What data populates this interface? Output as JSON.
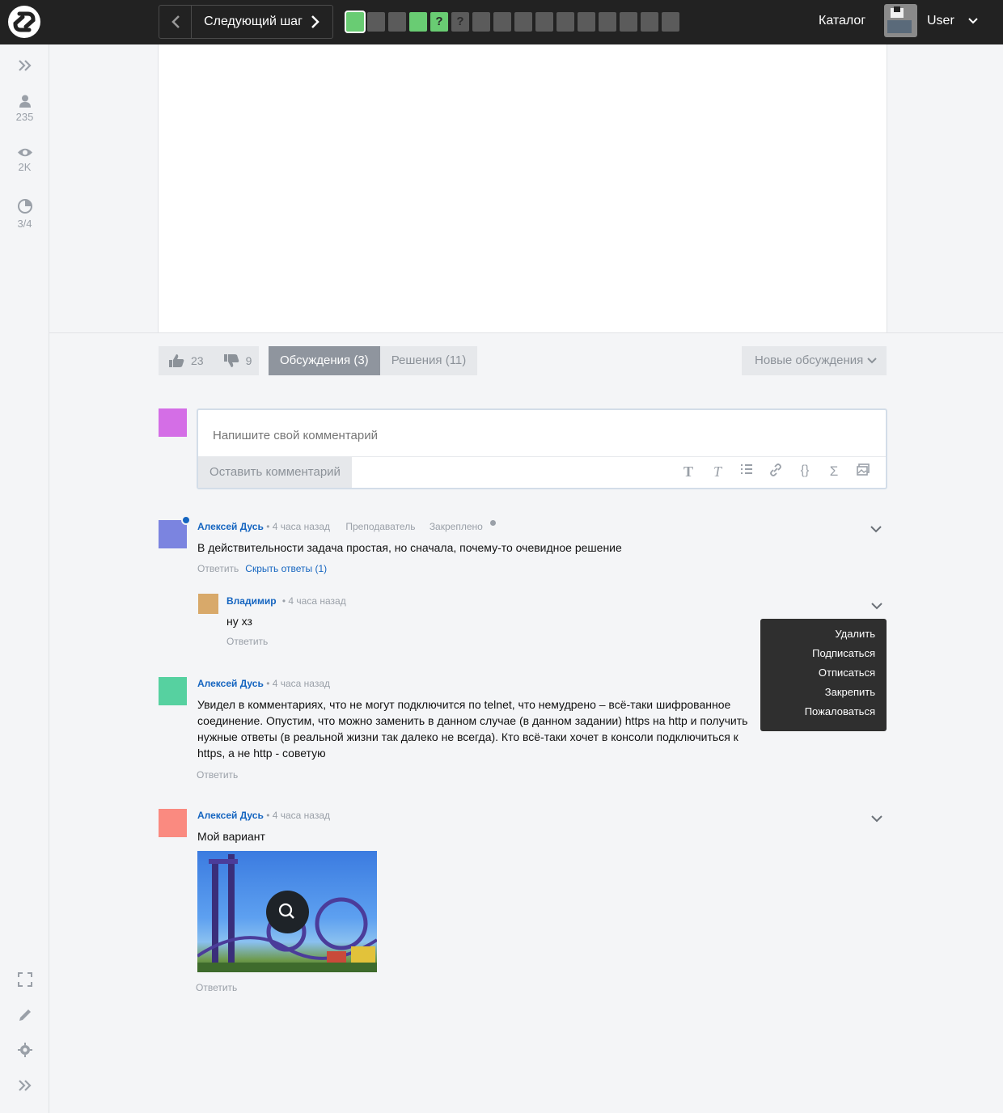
{
  "header": {
    "next_step_label": "Следующий шаг",
    "steps": [
      {
        "state": "green",
        "label": "",
        "active": true
      },
      {
        "state": "grey",
        "label": ""
      },
      {
        "state": "grey",
        "label": ""
      },
      {
        "state": "green",
        "label": ""
      },
      {
        "state": "green",
        "label": "?"
      },
      {
        "state": "grey",
        "label": "?"
      },
      {
        "state": "grey",
        "label": ""
      },
      {
        "state": "grey",
        "label": ""
      },
      {
        "state": "grey",
        "label": ""
      },
      {
        "state": "grey",
        "label": ""
      },
      {
        "state": "grey",
        "label": ""
      },
      {
        "state": "grey",
        "label": ""
      },
      {
        "state": "grey",
        "label": ""
      },
      {
        "state": "grey",
        "label": ""
      },
      {
        "state": "grey",
        "label": ""
      },
      {
        "state": "grey",
        "label": ""
      }
    ],
    "catalog_label": "Каталог",
    "user_name": "User"
  },
  "sidebar": {
    "learners": "235",
    "views": "2K",
    "progress": "3/4"
  },
  "discussion": {
    "likes": "23",
    "dislikes": "9",
    "tab_discussions": "Обсуждения (3)",
    "tab_solutions": "Решения (11)",
    "sort_label": "Новые обсуждения",
    "input_placeholder": "Напишите свой комментарий",
    "submit_label": "Оставить комментарий",
    "tools": [
      "T",
      "𝑇",
      "☰",
      "🔗",
      "{}",
      "Σ",
      "▣"
    ]
  },
  "comments": [
    {
      "author": "Алексей Дусь",
      "time": "• 4 часа назад",
      "role": "Преподаватель",
      "pinned": "Закреплено",
      "text": "В действительности задача простая, но сначала, почему-то очевидное решение",
      "reply": "Ответить",
      "hide_replies": "Скрыть ответы (1)",
      "avatar_color": "#7b84e0"
    },
    {
      "author": "Владимир",
      "time": "• 4 часа назад",
      "text": "ну хз",
      "reply": "Ответить",
      "avatar_color": "#d8a96a"
    },
    {
      "author": "Алексей Дусь",
      "time": "• 4 часа назад",
      "text": "Увидел в комментариях, что не могут подключится по telnet, что немудрено – всё-таки шифрованное соединение. Опустим, что можно заменить в данном случае (в данном задании) https на http и получить нужные ответы (в реальной жизни так далеко не всегда). Кто всё-таки хочет в консоли подключиться к https, а не http - советую",
      "reply": "Ответить",
      "avatar_color": "#56d1a0"
    },
    {
      "author": "Алексей Дусь",
      "time": "• 4 часа назад",
      "text": "Мой вариант",
      "reply": "Ответить",
      "avatar_color": "#fa8a80"
    }
  ],
  "context_menu": [
    "Удалить",
    "Подписаться",
    "Отписаться",
    "Закрепить",
    "Пожаловаться"
  ],
  "colors": {
    "topbar": "#222222",
    "green_step": "#69cc73",
    "link_blue": "#1565c0",
    "my_avatar": "#d46ee6"
  },
  "icons": [
    "logo-icon",
    "chevron-left-icon",
    "chevron-right-icon",
    "chevrons-right-icon",
    "user-icon",
    "eye-icon",
    "pie-progress-icon",
    "fullscreen-icon",
    "pencil-icon",
    "gear-icon",
    "thumbs-up-icon",
    "thumbs-down-icon",
    "chevron-down-icon",
    "search-icon"
  ]
}
